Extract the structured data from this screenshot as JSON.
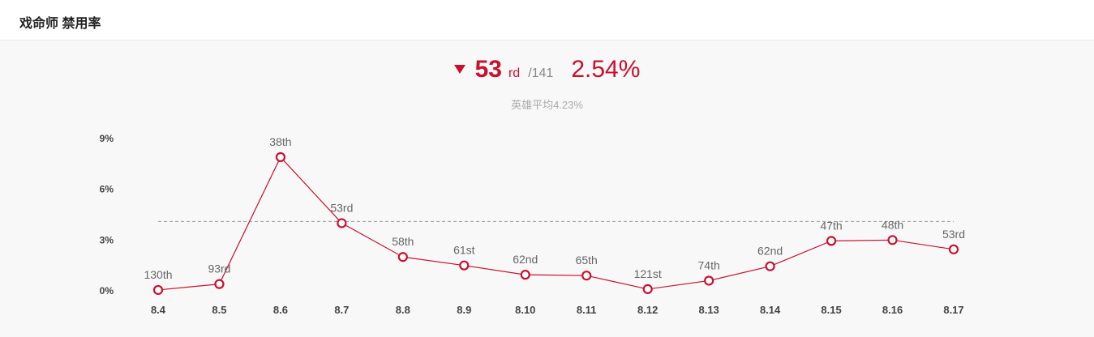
{
  "header": {
    "title": "戏命师 禁用率"
  },
  "summary": {
    "rank": "53",
    "rank_suffix": "rd",
    "rank_total": "/141",
    "rate": "2.54%",
    "average": "英雄平均4.23%",
    "trend": "down"
  },
  "colors": {
    "accent": "#c8102e",
    "avg_line": "#999999"
  },
  "chart_data": {
    "type": "line",
    "title": "",
    "xlabel": "",
    "ylabel": "",
    "ylim": [
      0,
      9
    ],
    "yticks": [
      "0%",
      "3%",
      "6%",
      "9%"
    ],
    "ytick_values": [
      0,
      3,
      6,
      9
    ],
    "categories": [
      "8.4",
      "8.5",
      "8.6",
      "8.7",
      "8.8",
      "8.9",
      "8.10",
      "8.11",
      "8.12",
      "8.13",
      "8.14",
      "8.15",
      "8.16",
      "8.17"
    ],
    "series": [
      {
        "values": [
          0.05,
          0.4,
          7.9,
          4.0,
          2.0,
          1.5,
          0.95,
          0.9,
          0.1,
          0.6,
          1.45,
          2.95,
          3.0,
          2.45
        ],
        "labels": [
          "130th",
          "93rd",
          "38th",
          "53rd",
          "58th",
          "61st",
          "62nd",
          "65th",
          "121st",
          "74th",
          "62nd",
          "47th",
          "48th",
          "53rd"
        ]
      }
    ],
    "reference_line": {
      "value": 4.1
    },
    "grid": false,
    "legend": "none"
  }
}
